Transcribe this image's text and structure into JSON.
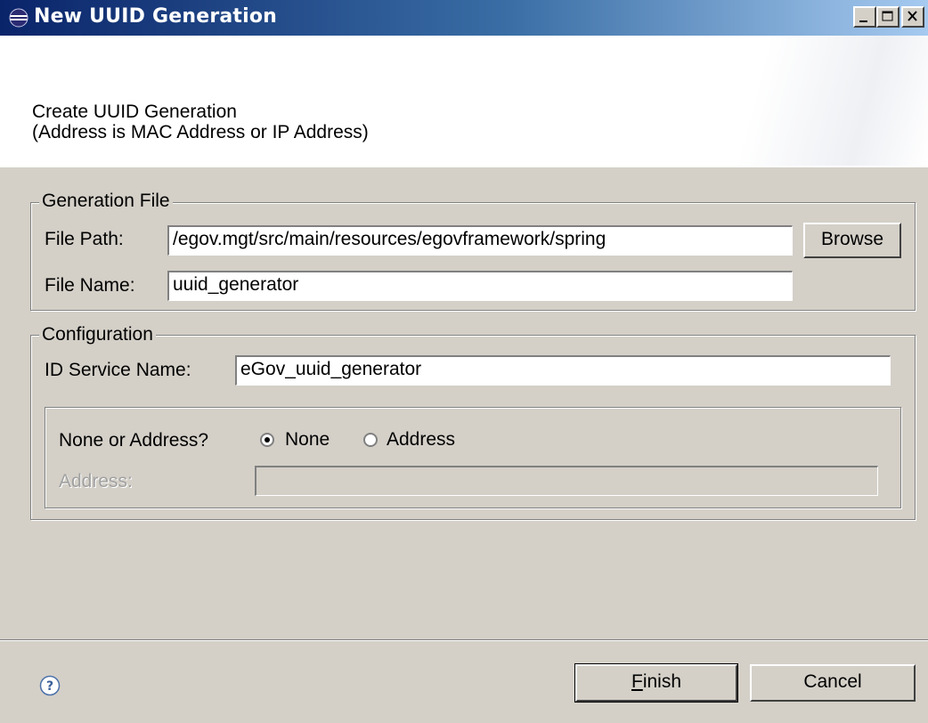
{
  "window": {
    "title": "New UUID Generation"
  },
  "banner": {
    "line1": "Create UUID Generation",
    "line2": "(Address is MAC Address or IP Address)"
  },
  "generation_file": {
    "legend": "Generation File",
    "file_path_label": "File Path:",
    "file_path_value": "/egov.mgt/src/main/resources/egovframework/spring",
    "browse_label": "Browse",
    "file_name_label": "File Name:",
    "file_name_value": "uuid_generator"
  },
  "configuration": {
    "legend": "Configuration",
    "id_service_label": "ID Service Name:",
    "id_service_value": "eGov_uuid_generator",
    "mode_question": "None or Address?",
    "option_none": "None",
    "option_address": "Address",
    "selected_option": "None",
    "address_label": "Address:",
    "address_value": ""
  },
  "footer": {
    "finish_mnemonic": "F",
    "finish_rest": "inish",
    "cancel_label": "Cancel"
  },
  "icons": {
    "title": "eclipse-icon",
    "help": "help-icon"
  },
  "colors": {
    "title_bar_start": "#0a246a",
    "title_bar_end": "#a6caf0",
    "dialog_bg": "#d4d0c8"
  }
}
